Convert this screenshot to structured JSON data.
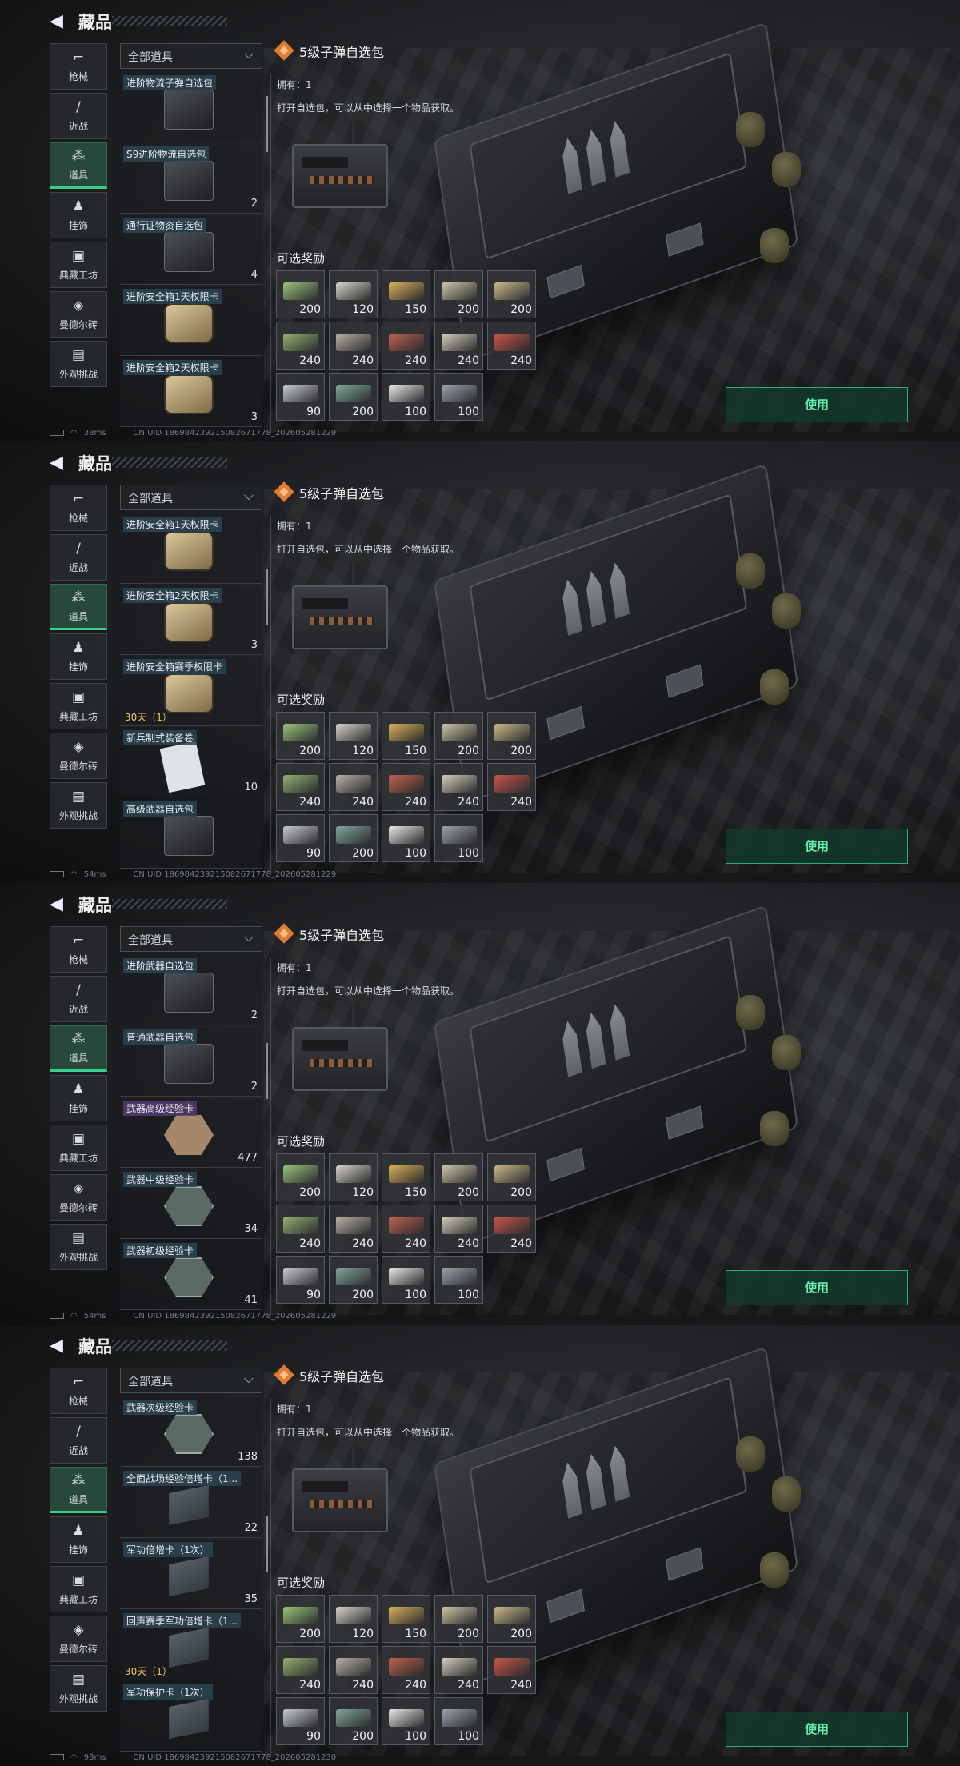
{
  "title": "藏品",
  "filter": "全部道具",
  "nav": [
    {
      "label": "枪械",
      "icon": "pistol-icon"
    },
    {
      "label": "近战",
      "icon": "knife-icon"
    },
    {
      "label": "道具",
      "icon": "items-icon"
    },
    {
      "label": "挂饰",
      "icon": "charm-icon"
    },
    {
      "label": "典藏工坊",
      "icon": "workshop-icon"
    },
    {
      "label": "曼德尔砖",
      "icon": "brick-icon"
    },
    {
      "label": "外观挑战",
      "icon": "challenge-icon"
    }
  ],
  "active_nav": "道具",
  "detail": {
    "name": "5级子弹自选包",
    "own": "拥有：1",
    "desc": "打开自选包，可以从中选择一个物品获取。",
    "rewards_title": "可选奖励",
    "use": "使用",
    "rewards": [
      {
        "q": "200",
        "color": "#9ac47b"
      },
      {
        "q": "120",
        "color": "#d6d3c9"
      },
      {
        "q": "150",
        "color": "#d9b25a"
      },
      {
        "q": "200",
        "color": "#cfc7a8"
      },
      {
        "q": "200",
        "color": "#cbb98a"
      },
      {
        "q": "240",
        "color": "#93b371"
      },
      {
        "q": "240",
        "color": "#b9b2a6"
      },
      {
        "q": "240",
        "color": "#c0624d"
      },
      {
        "q": "240",
        "color": "#d7d0bd"
      },
      {
        "q": "240",
        "color": "#c9564a"
      },
      {
        "q": "90",
        "color": "#c9cccf"
      },
      {
        "q": "200",
        "color": "#7fa79c"
      },
      {
        "q": "100",
        "color": "#e8e8e6"
      },
      {
        "q": "100",
        "color": "#9ea3ae"
      }
    ]
  },
  "frames": [
    {
      "status": {
        "ping": "38ms",
        "uid": "CN UID 1869842392150826717​78_202605281229"
      },
      "items": [
        {
          "label": "进阶物流子弹自选包",
          "count": "",
          "pic": "box"
        },
        {
          "label": "S9进阶物流自选包",
          "count": "2",
          "pic": "box"
        },
        {
          "label": "通行证物资自选包",
          "count": "4",
          "pic": "box"
        },
        {
          "label": "进阶安全箱1天权限卡",
          "count": "",
          "pic": "safe"
        },
        {
          "label": "进阶安全箱2天权限卡",
          "count": "3",
          "pic": "safe"
        }
      ]
    },
    {
      "status": {
        "ping": "54ms",
        "uid": "CN UID 1869842392150826717​78_202605281229"
      },
      "items": [
        {
          "label": "进阶安全箱1天权限卡",
          "count": "",
          "pic": "safe"
        },
        {
          "label": "进阶安全箱2天权限卡",
          "count": "3",
          "pic": "safe"
        },
        {
          "label": "进阶安全箱赛季权限卡",
          "count": "",
          "pic": "safe",
          "timer": "30天（1）"
        },
        {
          "label": "新兵制式装备卷",
          "count": "10",
          "pic": "paper"
        },
        {
          "label": "高级武器自选包",
          "count": "",
          "pic": "box"
        }
      ]
    },
    {
      "status": {
        "ping": "54ms",
        "uid": "CN UID 1869842392150826717​78_202605281229"
      },
      "items": [
        {
          "label": "进阶武器自选包",
          "count": "2",
          "pic": "box"
        },
        {
          "label": "普通武器自选包",
          "count": "2",
          "pic": "box"
        },
        {
          "label": "武器高级经验卡",
          "count": "477",
          "pic": "hexg",
          "style": "purple"
        },
        {
          "label": "武器中级经验卡",
          "count": "34",
          "pic": "hex"
        },
        {
          "label": "武器初级经验卡",
          "count": "41",
          "pic": "hex"
        }
      ]
    },
    {
      "status": {
        "ping": "93ms",
        "uid": "CN UID 1869842392150826717​78_202605281230"
      },
      "items": [
        {
          "label": "武器次级经验卡",
          "count": "138",
          "pic": "hex"
        },
        {
          "label": "全面战场经验倍增卡（1...",
          "count": "22",
          "pic": "card3d"
        },
        {
          "label": "军功倍增卡（1次）",
          "count": "35",
          "pic": "card3d"
        },
        {
          "label": "回声赛季军功倍增卡（1...",
          "count": "",
          "pic": "card3d",
          "timer": "30天（1）"
        },
        {
          "label": "军功保护卡（1次）",
          "count": "",
          "pic": "card3d"
        }
      ]
    }
  ]
}
